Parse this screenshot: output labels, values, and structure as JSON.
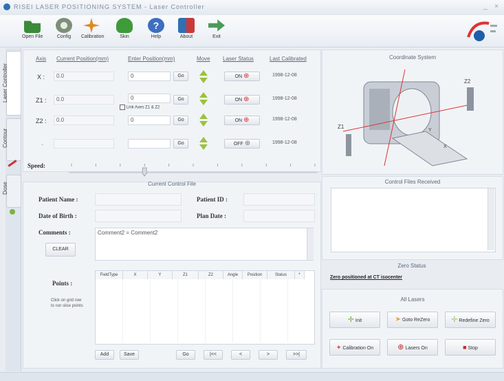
{
  "window": {
    "title": "RISEI LASER POSITIONING SYSTEM - Laser Controller",
    "minimize": "_",
    "close": "×"
  },
  "toolbar": [
    {
      "label": "Open File",
      "icon": "open-file-icon",
      "color": "#3a8a3a"
    },
    {
      "label": "Config",
      "icon": "config-icon",
      "color": "#7d8f78"
    },
    {
      "label": "Calibration",
      "icon": "calibration-icon",
      "color": "#e08a1e"
    },
    {
      "label": "Skin",
      "icon": "skin-icon",
      "color": "#3f9a3a"
    },
    {
      "label": "Help",
      "icon": "help-icon",
      "color": "#3c6fc0"
    },
    {
      "label": "About",
      "icon": "about-icon",
      "color": "#c83a3a"
    },
    {
      "label": "Exit",
      "icon": "exit-icon",
      "color": "#4a9a5a"
    }
  ],
  "side_tabs": [
    "Laser Controller",
    "Contour",
    "Dose"
  ],
  "laser_table": {
    "headers": [
      "Axis",
      "Current Position(mm)",
      "Enter Position(mm)",
      "Move",
      "Laser Status",
      "Last Calibrated"
    ],
    "go_label": "Go",
    "rows": [
      {
        "axis": "X :",
        "current": "0.0",
        "enter": "0",
        "status": "ON",
        "calibrated": "1998-12-08"
      },
      {
        "axis": "Z1 :",
        "current": "0.0",
        "enter": "0",
        "status": "ON",
        "calibrated": "1998-12-08"
      },
      {
        "axis": "Z2 :",
        "current": "0.0",
        "enter": "0",
        "status": "ON",
        "calibrated": "1998-12-08"
      },
      {
        "axis": "-",
        "current": "",
        "enter": "",
        "status": "OFF",
        "calibrated": "1998-12-08"
      }
    ],
    "link_label": "Link Axes Z1 & Z2",
    "link_checked": false
  },
  "speed": {
    "label": "Speed:",
    "value": 0.3
  },
  "coord": {
    "title": "Coordinate System",
    "labels": [
      "Z2",
      "Z1",
      "Y",
      "X"
    ]
  },
  "control_file": {
    "title": "Current Control File",
    "patient_name_label": "Patient Name :",
    "patient_id_label": "Patient ID :",
    "dob_label": "Date of Birth :",
    "plan_date_label": "Plan Date :",
    "comments_label": "Comments :",
    "comments_value": "Comment2 = Comment2",
    "clear_label": "CLEAR",
    "points_label": "Points :",
    "points_hint": "Click on grid row to run slice points",
    "grid_headers": [
      "FieldType",
      "X",
      "Y",
      "Z1",
      "Z2",
      "Angle",
      "Position",
      "Status",
      "*"
    ],
    "buttons": [
      "Add",
      "Save",
      "Go",
      "|<<",
      "<",
      ">",
      ">>|"
    ]
  },
  "received": {
    "title": "Control Files Received"
  },
  "zero": {
    "title": "Zero Status",
    "status_text": "Zero positioned at CT isocenter"
  },
  "all_lasers": {
    "title": "All Lasers",
    "buttons": [
      {
        "label": "Init",
        "icon": "crosshair-icon",
        "color": "#7cb342"
      },
      {
        "label": "Goto ReZero",
        "icon": "rezero-icon",
        "color": "#e6a23c"
      },
      {
        "label": "Redefine Zero",
        "icon": "redefine-icon",
        "color": "#9ccc65"
      },
      {
        "label": "Calibration On",
        "icon": "calibration-on-icon",
        "color": "#d84343"
      },
      {
        "label": "Lasers On",
        "icon": "lasers-on-icon",
        "color": "#c62828"
      },
      {
        "label": "Stop",
        "icon": "stop-icon",
        "color": "#c62828"
      }
    ]
  }
}
